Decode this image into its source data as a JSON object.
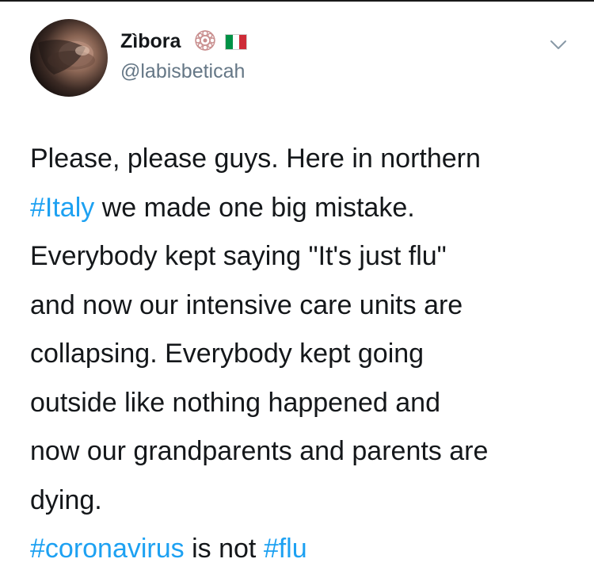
{
  "tweet": {
    "display_name": "Zìbora",
    "handle": "@labisbeticah",
    "lines": [
      {
        "text": "Please, please guys. Here in northern"
      },
      {
        "hashtag": "#Italy",
        "text": " we made one big mistake."
      },
      {
        "text": "Everybody kept saying \"It's just flu\""
      },
      {
        "text": "and now our intensive care units are"
      },
      {
        "text": "collapsing. Everybody kept going"
      },
      {
        "text": "outside like nothing happened and"
      },
      {
        "text": "now our grandparents and parents are"
      },
      {
        "text": "dying."
      },
      {
        "hashtag": "#coronavirus",
        "text": " is not ",
        "hashtag2": "#flu"
      }
    ]
  },
  "icons": {
    "avatar": "profile-photo",
    "badge": "rose-emblem-icon",
    "flag": "italy-flag-icon",
    "chevron": "chevron-down-icon"
  },
  "colors": {
    "hashtag": "#1da1f2",
    "handle": "#657786",
    "text": "#14171a",
    "chevron": "#8899a6",
    "flag_green": "#009246",
    "flag_white": "#ffffff",
    "flag_red": "#ce2b37"
  }
}
